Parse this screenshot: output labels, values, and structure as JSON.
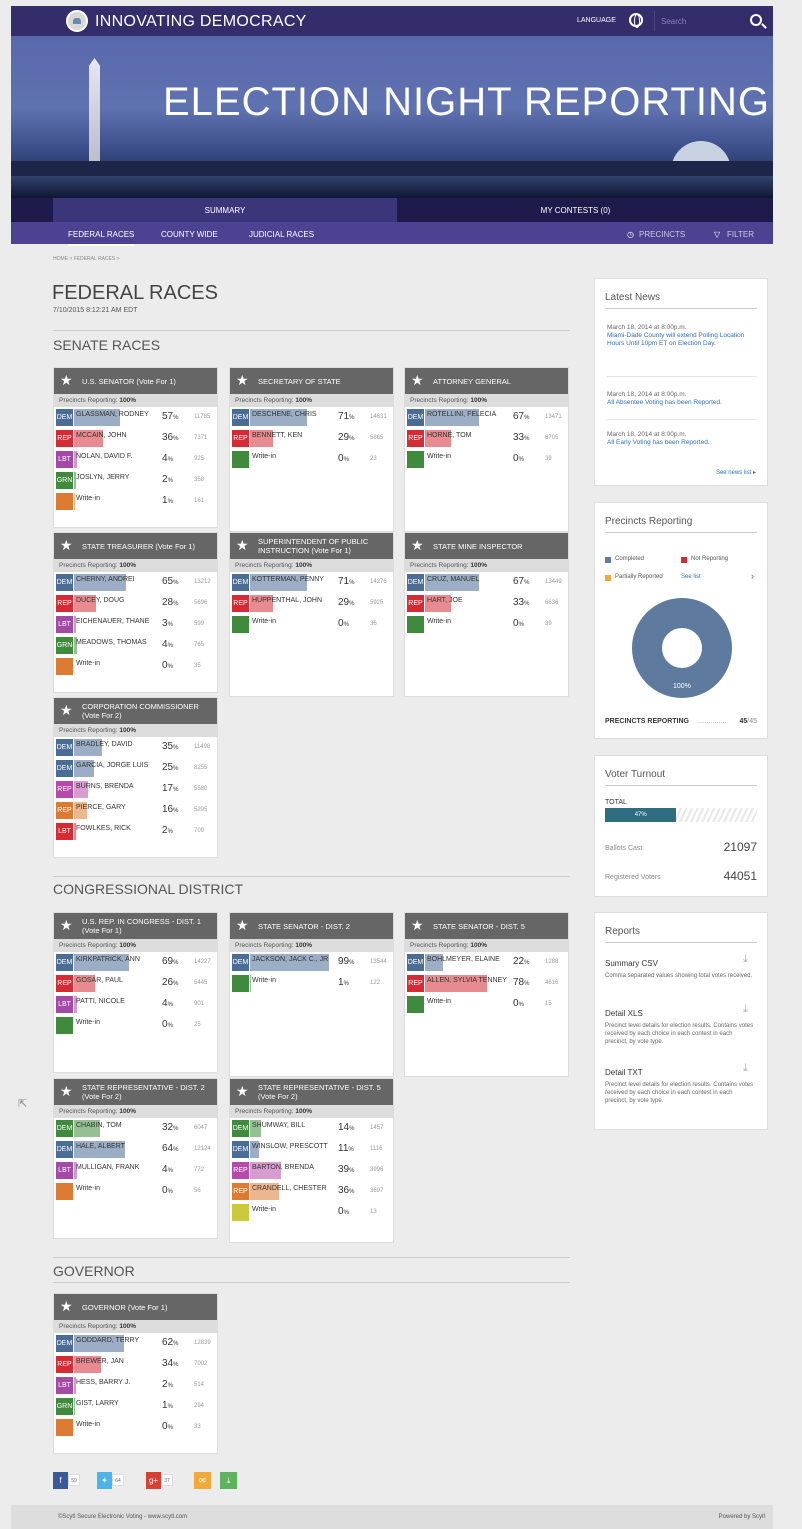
{
  "header": {
    "brand": "INNOVATING DEMOCRACY",
    "language": "LANGUAGE",
    "search_placeholder": "Search"
  },
  "hero": {
    "title": "ELECTION NIGHT REPORTING"
  },
  "nav": {
    "summary": "SUMMARY",
    "my_contests": "MY CONTESTS (0)",
    "federal": "FEDERAL RACES",
    "county": "COUNTY WIDE",
    "judicial": "JUDICIAL RACES",
    "precincts": "PRECINCTS",
    "filter": "FILTER"
  },
  "breadcrumb": "HOME  >  FEDERAL RACES  >",
  "page": {
    "title": "FEDERAL RACES",
    "date": "7/10/2015 8:12:21 AM EDT"
  },
  "sections": {
    "senate": "SENATE RACES",
    "congress": "CONGRESSIONAL DISTRICT",
    "governor": "GOVERNOR"
  },
  "precincts_label": "Precincts Reporting:",
  "precincts_value": "100%",
  "party_colors": {
    "DEM": "#4a6c95",
    "REP": "#d42b34",
    "LBT": "#a24aa6",
    "GRN": "#3f8a3c",
    "WI": "#dd7b33",
    "WI2": "#c9c93a"
  },
  "contests": [
    {
      "title": "U.S. SENATOR (Vote For 1)",
      "rows": [
        {
          "party": "DEM",
          "name": "GLASSMAN, RODNEY",
          "pct": "57",
          "votes": "11785",
          "share": 0.57
        },
        {
          "party": "REP",
          "name": "MCCAIN, JOHN",
          "pct": "36",
          "votes": "7371",
          "share": 0.36
        },
        {
          "party": "LBT",
          "name": "NOLAN, DAVID F.",
          "pct": "4",
          "votes": "925",
          "share": 0.04
        },
        {
          "party": "GRN",
          "name": "JOSLYN, JERRY",
          "pct": "2",
          "votes": "358",
          "share": 0.02
        },
        {
          "party": "WI",
          "name": "Write-in",
          "pct": "1",
          "votes": "161",
          "share": 0.01
        }
      ]
    },
    {
      "title": "SECRETARY OF STATE",
      "rows": [
        {
          "party": "DEM",
          "name": "DESCHENE, CHRIS",
          "pct": "71",
          "votes": "14631",
          "share": 0.71
        },
        {
          "party": "REP",
          "name": "BENNETT, KEN",
          "pct": "29",
          "votes": "5865",
          "share": 0.29
        },
        {
          "party": "GRN",
          "name": "Write-in",
          "pct": "0",
          "votes": "23",
          "share": 0
        }
      ]
    },
    {
      "title": "ATTORNEY GENERAL",
      "rows": [
        {
          "party": "DEM",
          "name": "ROTELLINI, FELECIA",
          "pct": "67",
          "votes": "13471",
          "share": 0.67
        },
        {
          "party": "REP",
          "name": "HORNE, TOM",
          "pct": "33",
          "votes": "6705",
          "share": 0.33
        },
        {
          "party": "GRN",
          "name": "Write-in",
          "pct": "0",
          "votes": "39",
          "share": 0
        }
      ]
    },
    {
      "title": "STATE TREASURER (Vote For 1)",
      "rows": [
        {
          "party": "DEM",
          "name": "CHERNY, ANDREI",
          "pct": "65",
          "votes": "13212",
          "share": 0.65
        },
        {
          "party": "REP",
          "name": "DUCEY, DOUG",
          "pct": "28",
          "votes": "5696",
          "share": 0.28
        },
        {
          "party": "LBT",
          "name": "EICHENAUER, THANE",
          "pct": "3",
          "votes": "599",
          "share": 0.03
        },
        {
          "party": "GRN",
          "name": "MEADOWS, THOMAS",
          "pct": "4",
          "votes": "765",
          "share": 0.04
        },
        {
          "party": "WI",
          "name": "Write-in",
          "pct": "0",
          "votes": "35",
          "share": 0
        }
      ]
    },
    {
      "title": "SUPERINTENDENT OF PUBLIC INSTRUCTION (Vote For 1)",
      "rows": [
        {
          "party": "DEM",
          "name": "KOTTERMAN, PENNY",
          "pct": "71",
          "votes": "14276",
          "share": 0.71
        },
        {
          "party": "REP",
          "name": "HUPPENTHAL, JOHN",
          "pct": "29",
          "votes": "5925",
          "share": 0.29
        },
        {
          "party": "GRN",
          "name": "Write-in",
          "pct": "0",
          "votes": "36",
          "share": 0
        }
      ]
    },
    {
      "title": "STATE MINE INSPECTOR",
      "rows": [
        {
          "party": "DEM",
          "name": "CRUZ, MANUEL",
          "pct": "67",
          "votes": "13449",
          "share": 0.67
        },
        {
          "party": "REP",
          "name": "HART, JOE",
          "pct": "33",
          "votes": "6636",
          "share": 0.33
        },
        {
          "party": "GRN",
          "name": "Write-in",
          "pct": "0",
          "votes": "39",
          "share": 0
        }
      ]
    },
    {
      "title": "CORPORATION COMMISSIONER (Vote For 2)",
      "rows": [
        {
          "party": "DEM",
          "name": "BRADLEY, DAVID",
          "pct": "35",
          "votes": "11498",
          "share": 0.35
        },
        {
          "party": "DEM",
          "name": "GARCIA, JORGE LUIS",
          "pct": "25",
          "votes": "8255",
          "share": 0.25
        },
        {
          "party": "REP",
          "name": "BURNS, BRENDA",
          "pct": "17",
          "votes": "5580",
          "share": 0.17,
          "color": "#b64aa9"
        },
        {
          "party": "REP",
          "name": "PIERCE, GARY",
          "pct": "16",
          "votes": "5205",
          "share": 0.16,
          "color": "#dd7b33"
        },
        {
          "party": "LBT",
          "name": "FOWLKES, RICK",
          "pct": "2",
          "votes": "709",
          "share": 0.02,
          "color": "#d42b34"
        }
      ]
    },
    {
      "title": "U.S. REP. IN CONGRESS - DIST. 1 (Vote For 1)",
      "rows": [
        {
          "party": "DEM",
          "name": "KIRKPATRICK, ANN",
          "pct": "69",
          "votes": "14227",
          "share": 0.69
        },
        {
          "party": "REP",
          "name": "GOSAR, PAUL",
          "pct": "26",
          "votes": "5445",
          "share": 0.26
        },
        {
          "party": "LBT",
          "name": "PATTI, NICOLE",
          "pct": "4",
          "votes": "901",
          "share": 0.04
        },
        {
          "party": "GRN",
          "name": "Write-in",
          "pct": "0",
          "votes": "25",
          "share": 0
        }
      ]
    },
    {
      "title": "STATE SENATOR - DIST. 2",
      "rows": [
        {
          "party": "DEM",
          "name": "JACKSON, JACK C., JR",
          "pct": "99",
          "votes": "13544",
          "share": 0.99
        },
        {
          "party": "GRN",
          "name": "Write-in",
          "pct": "1",
          "votes": "122",
          "share": 0.01
        }
      ]
    },
    {
      "title": "STATE SENATOR - DIST. 5",
      "rows": [
        {
          "party": "DEM",
          "name": "BOHLMEYER, ELAINE",
          "pct": "22",
          "votes": "1288",
          "share": 0.22
        },
        {
          "party": "REP",
          "name": "ALLEN, SYLVIA TENNEY",
          "pct": "78",
          "votes": "4616",
          "share": 0.78
        },
        {
          "party": "GRN",
          "name": "Write-in",
          "pct": "0",
          "votes": "15",
          "share": 0
        }
      ]
    },
    {
      "title": "STATE REPRESENTATIVE - DIST. 2 (Vote For 2)",
      "rows": [
        {
          "party": "DEM",
          "name": "CHABIN, TOM",
          "pct": "32",
          "votes": "6047",
          "share": 0.32,
          "color": "#3f8a3c"
        },
        {
          "party": "DEM",
          "name": "HALE, ALBERT",
          "pct": "64",
          "votes": "12124",
          "share": 0.64
        },
        {
          "party": "LBT",
          "name": "MULLIGAN, FRANK",
          "pct": "4",
          "votes": "772",
          "share": 0.04
        },
        {
          "party": "WI",
          "name": "Write-in",
          "pct": "0",
          "votes": "56",
          "share": 0
        }
      ]
    },
    {
      "title": "STATE REPRESENTATIVE - DIST. 5 (Vote For 2)",
      "rows": [
        {
          "party": "DEM",
          "name": "SHUMWAY, BILL",
          "pct": "14",
          "votes": "1457",
          "share": 0.14,
          "color": "#3f8a3c"
        },
        {
          "party": "DEM",
          "name": "WINSLOW, PRESCOTT",
          "pct": "11",
          "votes": "1116",
          "share": 0.11
        },
        {
          "party": "REP",
          "name": "BARTON, BRENDA",
          "pct": "39",
          "votes": "3996",
          "share": 0.39,
          "color": "#b64aa9"
        },
        {
          "party": "REP",
          "name": "CRANDELL, CHESTER",
          "pct": "36",
          "votes": "3697",
          "share": 0.36,
          "color": "#dd7b33"
        },
        {
          "party": "WI2",
          "name": "Write-in",
          "pct": "0",
          "votes": "13",
          "share": 0
        }
      ]
    },
    {
      "title": "GOVERNOR (Vote For 1)",
      "rows": [
        {
          "party": "DEM",
          "name": "GODDARD, TERRY",
          "pct": "62",
          "votes": "12839",
          "share": 0.62
        },
        {
          "party": "REP",
          "name": "BREWER, JAN",
          "pct": "34",
          "votes": "7002",
          "share": 0.34
        },
        {
          "party": "LBT",
          "name": "HESS, BARRY J.",
          "pct": "2",
          "votes": "514",
          "share": 0.02
        },
        {
          "party": "GRN",
          "name": "GIST, LARRY",
          "pct": "1",
          "votes": "294",
          "share": 0.01
        },
        {
          "party": "WI",
          "name": "Write-in",
          "pct": "0",
          "votes": "33",
          "share": 0
        }
      ]
    }
  ],
  "news": {
    "title": "Latest News",
    "items": [
      {
        "date": "March 18, 2014 at 8:00p.m.",
        "text": "Miami-Dade County will extend Polling Location Hours Until 10pm ET on Election Day."
      },
      {
        "date": "March 18, 2014 at 8:00p.m.",
        "text": "All Absentee Voting has been Reported."
      },
      {
        "date": "March 18, 2014 at 8:00p.m.",
        "text": "All Early Voting has been Reported."
      }
    ],
    "more": "See news list"
  },
  "precincts": {
    "title": "Precincts Reporting",
    "completed": "Completed",
    "not_reporting": "Not Reporting",
    "partial": "Partially Reported",
    "see_list": "See list",
    "donut_pct": "100%",
    "footer_label": "PRECINCTS REPORTING",
    "value": "45",
    "total": "/45",
    "completed_share": 1.0
  },
  "turnout": {
    "title": "Voter Turnout",
    "total_label": "TOTAL",
    "pct": "47%",
    "pct_value": 0.47,
    "ballots_label": "Ballots Cast",
    "ballots": "21097",
    "registered_label": "Registered Voters",
    "registered": "44051"
  },
  "reports": {
    "title": "Reports",
    "items": [
      {
        "name": "Summary CSV",
        "desc": "Comma separated values showing total votes received."
      },
      {
        "name": "Detail XLS",
        "desc": "Precinct level details for election results. Contains votes received by each choice in each contest in each precinct, by vote type."
      },
      {
        "name": "Detail TXT",
        "desc": "Precinct level details for election results. Contains votes received by each choice in each contest in each precinct, by vote type."
      }
    ]
  },
  "social": {
    "facebook": "59",
    "twitter": "64",
    "google": "37"
  },
  "footer": {
    "left": "©Scytl Secure Electronic Voting - www.scytl.com",
    "right": "Powered by Scytl"
  }
}
